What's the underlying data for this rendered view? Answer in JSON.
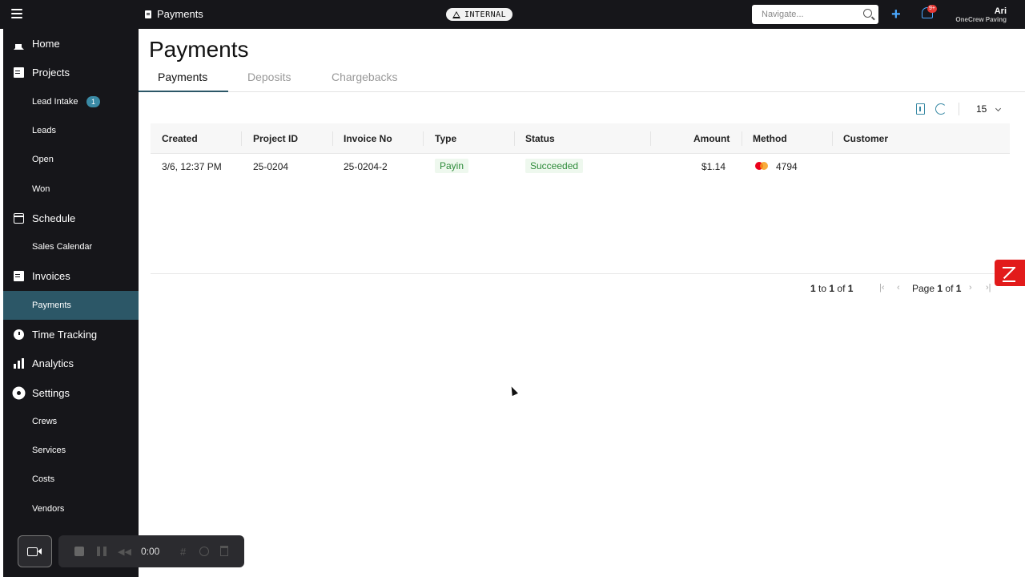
{
  "topbar": {
    "breadcrumb": "Payments",
    "env_badge": "INTERNAL",
    "search_placeholder": "Navigate...",
    "notifications_count": "9+",
    "user_name": "Ari",
    "company": "OneCrew Paving"
  },
  "sidebar": {
    "items": [
      {
        "label": "Home"
      },
      {
        "label": "Projects"
      },
      {
        "label": "Lead Intake",
        "badge": "1"
      },
      {
        "label": "Leads"
      },
      {
        "label": "Open"
      },
      {
        "label": "Won"
      },
      {
        "label": "Schedule"
      },
      {
        "label": "Sales Calendar"
      },
      {
        "label": "Invoices"
      },
      {
        "label": "Payments"
      },
      {
        "label": "Time Tracking"
      },
      {
        "label": "Analytics"
      },
      {
        "label": "Settings"
      },
      {
        "label": "Crews"
      },
      {
        "label": "Services"
      },
      {
        "label": "Costs"
      },
      {
        "label": "Vendors"
      }
    ],
    "active": "Payments"
  },
  "main": {
    "title": "Payments",
    "tabs": [
      {
        "label": "Payments"
      },
      {
        "label": "Deposits"
      },
      {
        "label": "Chargebacks"
      }
    ],
    "page_size": "15"
  },
  "table": {
    "columns": [
      "Created",
      "Project ID",
      "Invoice No",
      "Type",
      "Status",
      "Amount",
      "Method",
      "Customer"
    ],
    "rows": [
      {
        "created": "3/6, 12:37 PM",
        "project_id": "25-0204",
        "invoice_no": "25-0204-2",
        "type": "Payin",
        "status": "Succeeded",
        "amount": "$1.14",
        "method_last4": "4794",
        "method_icon": "mastercard-icon",
        "customer": ""
      }
    ]
  },
  "pagination": {
    "from": "1",
    "to_word": "to",
    "to": "1",
    "of_word": "of",
    "total": "1",
    "page_word": "Page",
    "page": "1",
    "pages": "1"
  },
  "recorder": {
    "time": "0:00"
  },
  "colors": {
    "sidebar_bg": "#16161a",
    "active_nav": "#2c5767",
    "accent": "#3a8aa5",
    "success": "#2e8b3a"
  }
}
